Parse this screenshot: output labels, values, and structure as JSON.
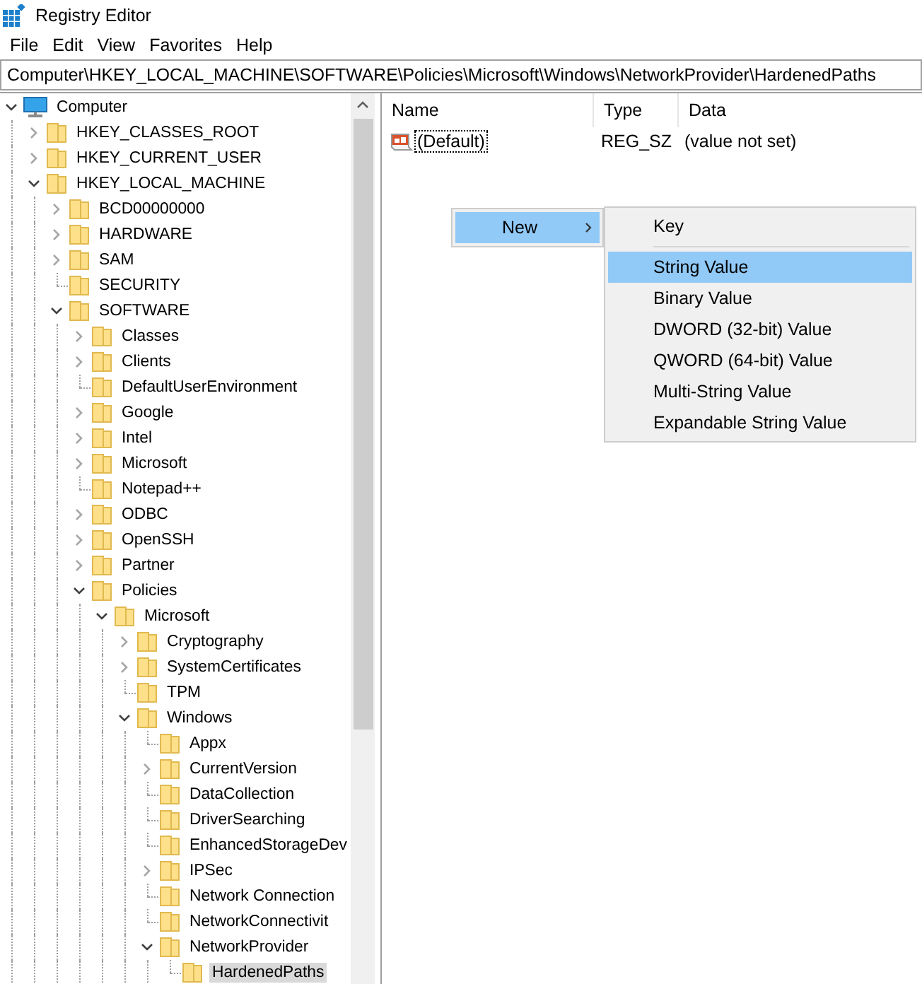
{
  "window": {
    "title": "Registry Editor"
  },
  "menu_bar": [
    "File",
    "Edit",
    "View",
    "Favorites",
    "Help"
  ],
  "address_bar": {
    "value": "Computer\\HKEY_LOCAL_MACHINE\\SOFTWARE\\Policies\\Microsoft\\Windows\\NetworkProvider\\HardenedPaths"
  },
  "tree": [
    {
      "label": "Computer",
      "kind": "computer",
      "has_subkeys": true,
      "expanded": true,
      "selected": false,
      "children": [
        {
          "label": "HKEY_CLASSES_ROOT",
          "has_subkeys": true,
          "expanded": false,
          "selected": false
        },
        {
          "label": "HKEY_CURRENT_USER",
          "has_subkeys": true,
          "expanded": false,
          "selected": false
        },
        {
          "label": "HKEY_LOCAL_MACHINE",
          "has_subkeys": true,
          "expanded": true,
          "selected": false,
          "children": [
            {
              "label": "BCD00000000",
              "has_subkeys": true,
              "expanded": false,
              "selected": false
            },
            {
              "label": "HARDWARE",
              "has_subkeys": true,
              "expanded": false,
              "selected": false
            },
            {
              "label": "SAM",
              "has_subkeys": true,
              "expanded": false,
              "selected": false
            },
            {
              "label": "SECURITY",
              "has_subkeys": false,
              "selected": false
            },
            {
              "label": "SOFTWARE",
              "has_subkeys": true,
              "expanded": true,
              "selected": false,
              "children": [
                {
                  "label": "Classes",
                  "has_subkeys": true,
                  "expanded": false,
                  "selected": false
                },
                {
                  "label": "Clients",
                  "has_subkeys": true,
                  "expanded": false,
                  "selected": false
                },
                {
                  "label": "DefaultUserEnvironment",
                  "has_subkeys": false,
                  "selected": false
                },
                {
                  "label": "Google",
                  "has_subkeys": true,
                  "expanded": false,
                  "selected": false
                },
                {
                  "label": "Intel",
                  "has_subkeys": true,
                  "expanded": false,
                  "selected": false
                },
                {
                  "label": "Microsoft",
                  "has_subkeys": true,
                  "expanded": false,
                  "selected": false
                },
                {
                  "label": "Notepad++",
                  "has_subkeys": false,
                  "selected": false
                },
                {
                  "label": "ODBC",
                  "has_subkeys": true,
                  "expanded": false,
                  "selected": false
                },
                {
                  "label": "OpenSSH",
                  "has_subkeys": true,
                  "expanded": false,
                  "selected": false
                },
                {
                  "label": "Partner",
                  "has_subkeys": true,
                  "expanded": false,
                  "selected": false
                },
                {
                  "label": "Policies",
                  "has_subkeys": true,
                  "expanded": true,
                  "selected": false,
                  "children": [
                    {
                      "label": "Microsoft",
                      "has_subkeys": true,
                      "expanded": true,
                      "selected": false,
                      "children": [
                        {
                          "label": "Cryptography",
                          "has_subkeys": true,
                          "expanded": false,
                          "selected": false
                        },
                        {
                          "label": "SystemCertificates",
                          "has_subkeys": true,
                          "expanded": false,
                          "selected": false
                        },
                        {
                          "label": "TPM",
                          "has_subkeys": false,
                          "selected": false
                        },
                        {
                          "label": "Windows",
                          "has_subkeys": true,
                          "expanded": true,
                          "selected": false,
                          "children": [
                            {
                              "label": "Appx",
                              "has_subkeys": false,
                              "selected": false
                            },
                            {
                              "label": "CurrentVersion",
                              "has_subkeys": true,
                              "expanded": false,
                              "selected": false
                            },
                            {
                              "label": "DataCollection",
                              "has_subkeys": false,
                              "selected": false
                            },
                            {
                              "label": "DriverSearching",
                              "has_subkeys": false,
                              "selected": false
                            },
                            {
                              "label": "EnhancedStorageDev",
                              "has_subkeys": false,
                              "selected": false
                            },
                            {
                              "label": "IPSec",
                              "has_subkeys": true,
                              "expanded": false,
                              "selected": false
                            },
                            {
                              "label": "Network Connection",
                              "has_subkeys": false,
                              "selected": false
                            },
                            {
                              "label": "NetworkConnectivit",
                              "has_subkeys": false,
                              "selected": false
                            },
                            {
                              "label": "NetworkProvider",
                              "has_subkeys": true,
                              "expanded": true,
                              "selected": false,
                              "children": [
                                {
                                  "label": "HardenedPaths",
                                  "has_subkeys": false,
                                  "selected": true
                                }
                              ]
                            }
                          ]
                        }
                      ]
                    }
                  ]
                }
              ]
            }
          ]
        }
      ]
    }
  ],
  "values_table": {
    "columns": [
      "Name",
      "Type",
      "Data"
    ],
    "rows": [
      {
        "name": "(Default)",
        "type": "REG_SZ",
        "data": "(value not set)",
        "focused": true
      }
    ]
  },
  "context_menu": {
    "items": [
      {
        "label": "New",
        "selected": true,
        "has_submenu": true
      }
    ]
  },
  "submenu": {
    "items": [
      {
        "kind": "item",
        "label": "Key",
        "selected": false
      },
      {
        "kind": "separator"
      },
      {
        "kind": "item",
        "label": "String Value",
        "selected": true
      },
      {
        "kind": "item",
        "label": "Binary Value",
        "selected": false
      },
      {
        "kind": "item",
        "label": "DWORD (32-bit) Value",
        "selected": false
      },
      {
        "kind": "item",
        "label": "QWORD (64-bit) Value",
        "selected": false
      },
      {
        "kind": "item",
        "label": "Multi-String Value",
        "selected": false
      },
      {
        "kind": "item",
        "label": "Expandable String Value",
        "selected": false
      }
    ]
  }
}
